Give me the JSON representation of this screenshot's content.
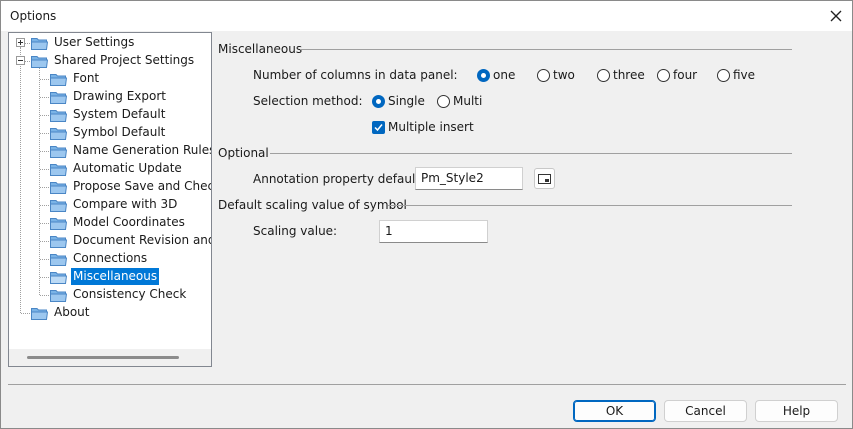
{
  "window": {
    "title": "Options"
  },
  "tree": {
    "items": [
      {
        "label": "User Settings"
      },
      {
        "label": "Shared Project Settings"
      },
      {
        "label": "Font"
      },
      {
        "label": "Drawing Export"
      },
      {
        "label": "System Default"
      },
      {
        "label": "Symbol Default"
      },
      {
        "label": "Name Generation Rules"
      },
      {
        "label": "Automatic Update"
      },
      {
        "label": "Propose Save and Check-ir"
      },
      {
        "label": "Compare with 3D"
      },
      {
        "label": "Model Coordinates"
      },
      {
        "label": "Document Revision and Pu"
      },
      {
        "label": "Connections"
      },
      {
        "label": "Miscellaneous"
      },
      {
        "label": "Consistency Check"
      },
      {
        "label": "About"
      }
    ],
    "selected": "Miscellaneous"
  },
  "misc": {
    "heading": "Miscellaneous",
    "columns_label": "Number of columns in data panel:",
    "columns_options": [
      "one",
      "two",
      "three",
      "four",
      "five"
    ],
    "columns_selected": "one",
    "selection_label": "Selection method:",
    "selection_options": [
      "Single",
      "Multi"
    ],
    "selection_selected": "Single",
    "multiple_insert_label": "Multiple insert",
    "multiple_insert_checked": true
  },
  "optional": {
    "heading": "Optional",
    "annotation_label": "Annotation property defaults:",
    "annotation_value": "Pm_Style2"
  },
  "scaling": {
    "heading": "Default scaling value of symbol",
    "scaling_label": "Scaling value:",
    "scaling_value": "1"
  },
  "buttons": {
    "ok": "OK",
    "cancel": "Cancel",
    "help": "Help"
  },
  "colors": {
    "accent": "#0067c0",
    "selection": "#0078d7",
    "folder": "#7ab3e6"
  }
}
